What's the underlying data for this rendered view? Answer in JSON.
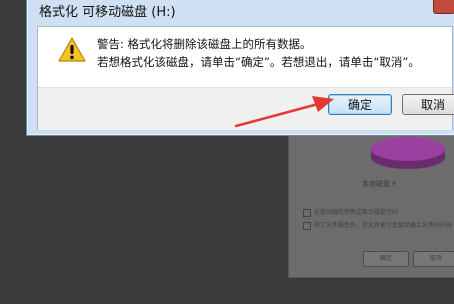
{
  "dialog": {
    "title": "格式化 可移动磁盘 (H:)",
    "message_line1": "警告: 格式化将删除该磁盘上的所有数据。",
    "message_line2": "若想格式化该磁盘，请单击“确定”。若想退出，请单击“取消”。",
    "ok_label": "确定",
    "cancel_label": "取消",
    "icon": "warning-icon"
  },
  "background_window": {
    "disk_label": "本地磁盘 F",
    "check1": "在驱动器名称旁边显示磁盘空间",
    "check2": "除了文件属性外，还允许索引此驱动器上文件的内容",
    "btn1": "确定",
    "btn2": "取消"
  },
  "colors": {
    "annotation_arrow": "#e53935",
    "disk_purple": "#9b3fa0"
  }
}
